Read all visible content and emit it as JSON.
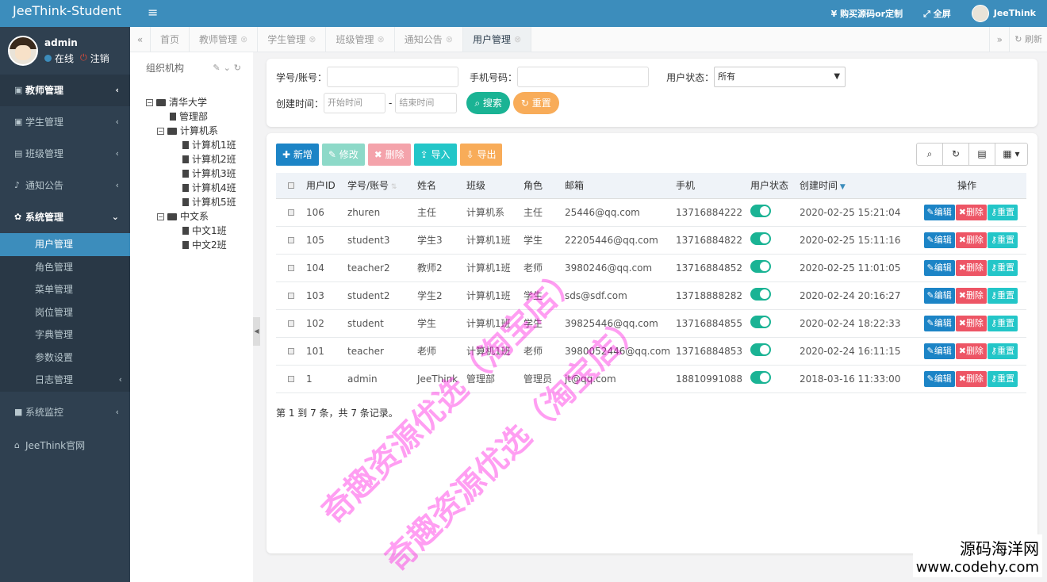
{
  "app": {
    "brand": "JeeThink-Student"
  },
  "user": {
    "name": "admin",
    "status": "在线",
    "logout": "注销"
  },
  "sidebar": {
    "groups": [
      {
        "label": "教师管理",
        "arrow": "‹"
      },
      {
        "label": "学生管理",
        "arrow": "‹"
      },
      {
        "label": "班级管理",
        "arrow": "‹"
      },
      {
        "label": "通知公告",
        "arrow": "‹"
      },
      {
        "label": "系统管理",
        "arrow": "⌄"
      }
    ],
    "submenu": [
      "用户管理",
      "角色管理",
      "菜单管理",
      "岗位管理",
      "字典管理",
      "参数设置",
      "日志管理"
    ],
    "monitor": "系统监控",
    "official": "JeeThink官网"
  },
  "topbar": {
    "buy": "¥ 购买源码or定制",
    "fullscreen": "全屏",
    "user": "JeeThink"
  },
  "tabs": [
    "首页",
    "教师管理",
    "学生管理",
    "班级管理",
    "通知公告",
    "用户管理"
  ],
  "tabs_refresh": "刷新",
  "tree": {
    "title": "组织机构",
    "root": "清华大学",
    "admin_dept": "管理部",
    "cs": "计算机系",
    "cs_classes": [
      "计算机1班",
      "计算机2班",
      "计算机3班",
      "计算机4班",
      "计算机5班"
    ],
    "cn": "中文系",
    "cn_classes": [
      "中文1班",
      "中文2班"
    ]
  },
  "search": {
    "account_label": "学号/账号：",
    "phone_label": "手机号码：",
    "status_label": "用户状态：",
    "status_value": "所有",
    "created_label": "创建时间：",
    "start_placeholder": "开始时间",
    "end_placeholder": "结束时间",
    "dash": "-",
    "search_btn": "搜索",
    "reset_btn": "重置"
  },
  "toolbar": {
    "add": "新增",
    "edit": "修改",
    "delete": "删除",
    "import": "导入",
    "export": "导出"
  },
  "table": {
    "headers": [
      "用户ID",
      "学号/账号",
      "姓名",
      "班级",
      "角色",
      "邮箱",
      "手机",
      "用户状态",
      "创建时间",
      "操作"
    ],
    "rows": [
      [
        "106",
        "zhuren",
        "主任",
        "计算机系",
        "主任",
        "25446@qq.com",
        "13716884222",
        "2020-02-25 15:21:04"
      ],
      [
        "105",
        "student3",
        "学生3",
        "计算机1班",
        "学生",
        "22205446@qq.com",
        "13716884822",
        "2020-02-25 15:11:16"
      ],
      [
        "104",
        "teacher2",
        "教师2",
        "计算机1班",
        "老师",
        "3980246@qq.com",
        "13716884852",
        "2020-02-25 11:01:05"
      ],
      [
        "103",
        "student2",
        "学生2",
        "计算机1班",
        "学生",
        "sds@sdf.com",
        "13718888282",
        "2020-02-24 20:16:27"
      ],
      [
        "102",
        "student",
        "学生",
        "计算机1班",
        "学生",
        "39825446@qq.com",
        "13716884855",
        "2020-02-24 18:22:33"
      ],
      [
        "101",
        "teacher",
        "老师",
        "计算机1班",
        "老师",
        "3980052446@qq.com",
        "13716884853",
        "2020-02-24 16:11:15"
      ],
      [
        "1",
        "admin",
        "JeeThink",
        "管理部",
        "管理员",
        "jt@qq.com",
        "18810991088",
        "2018-03-16 11:33:00"
      ]
    ],
    "row_actions": {
      "edit": "编辑",
      "delete": "删除",
      "reset": "重置"
    },
    "summary": "第 1 到 7 条，共 7 条记录。"
  },
  "watermark": {
    "line1": "奇趣资源优选（淘宝店）",
    "line2": "奇趣资源优选（淘宝店）"
  },
  "corner": {
    "cn": "源码海洋网",
    "url": "www.codehy.com"
  },
  "colors": {
    "primary": "#3c8dbc",
    "sidebar": "#2f4050",
    "success": "#1ab394",
    "danger": "#ed5565",
    "warning": "#f8ac59",
    "info": "#23c6c8"
  }
}
